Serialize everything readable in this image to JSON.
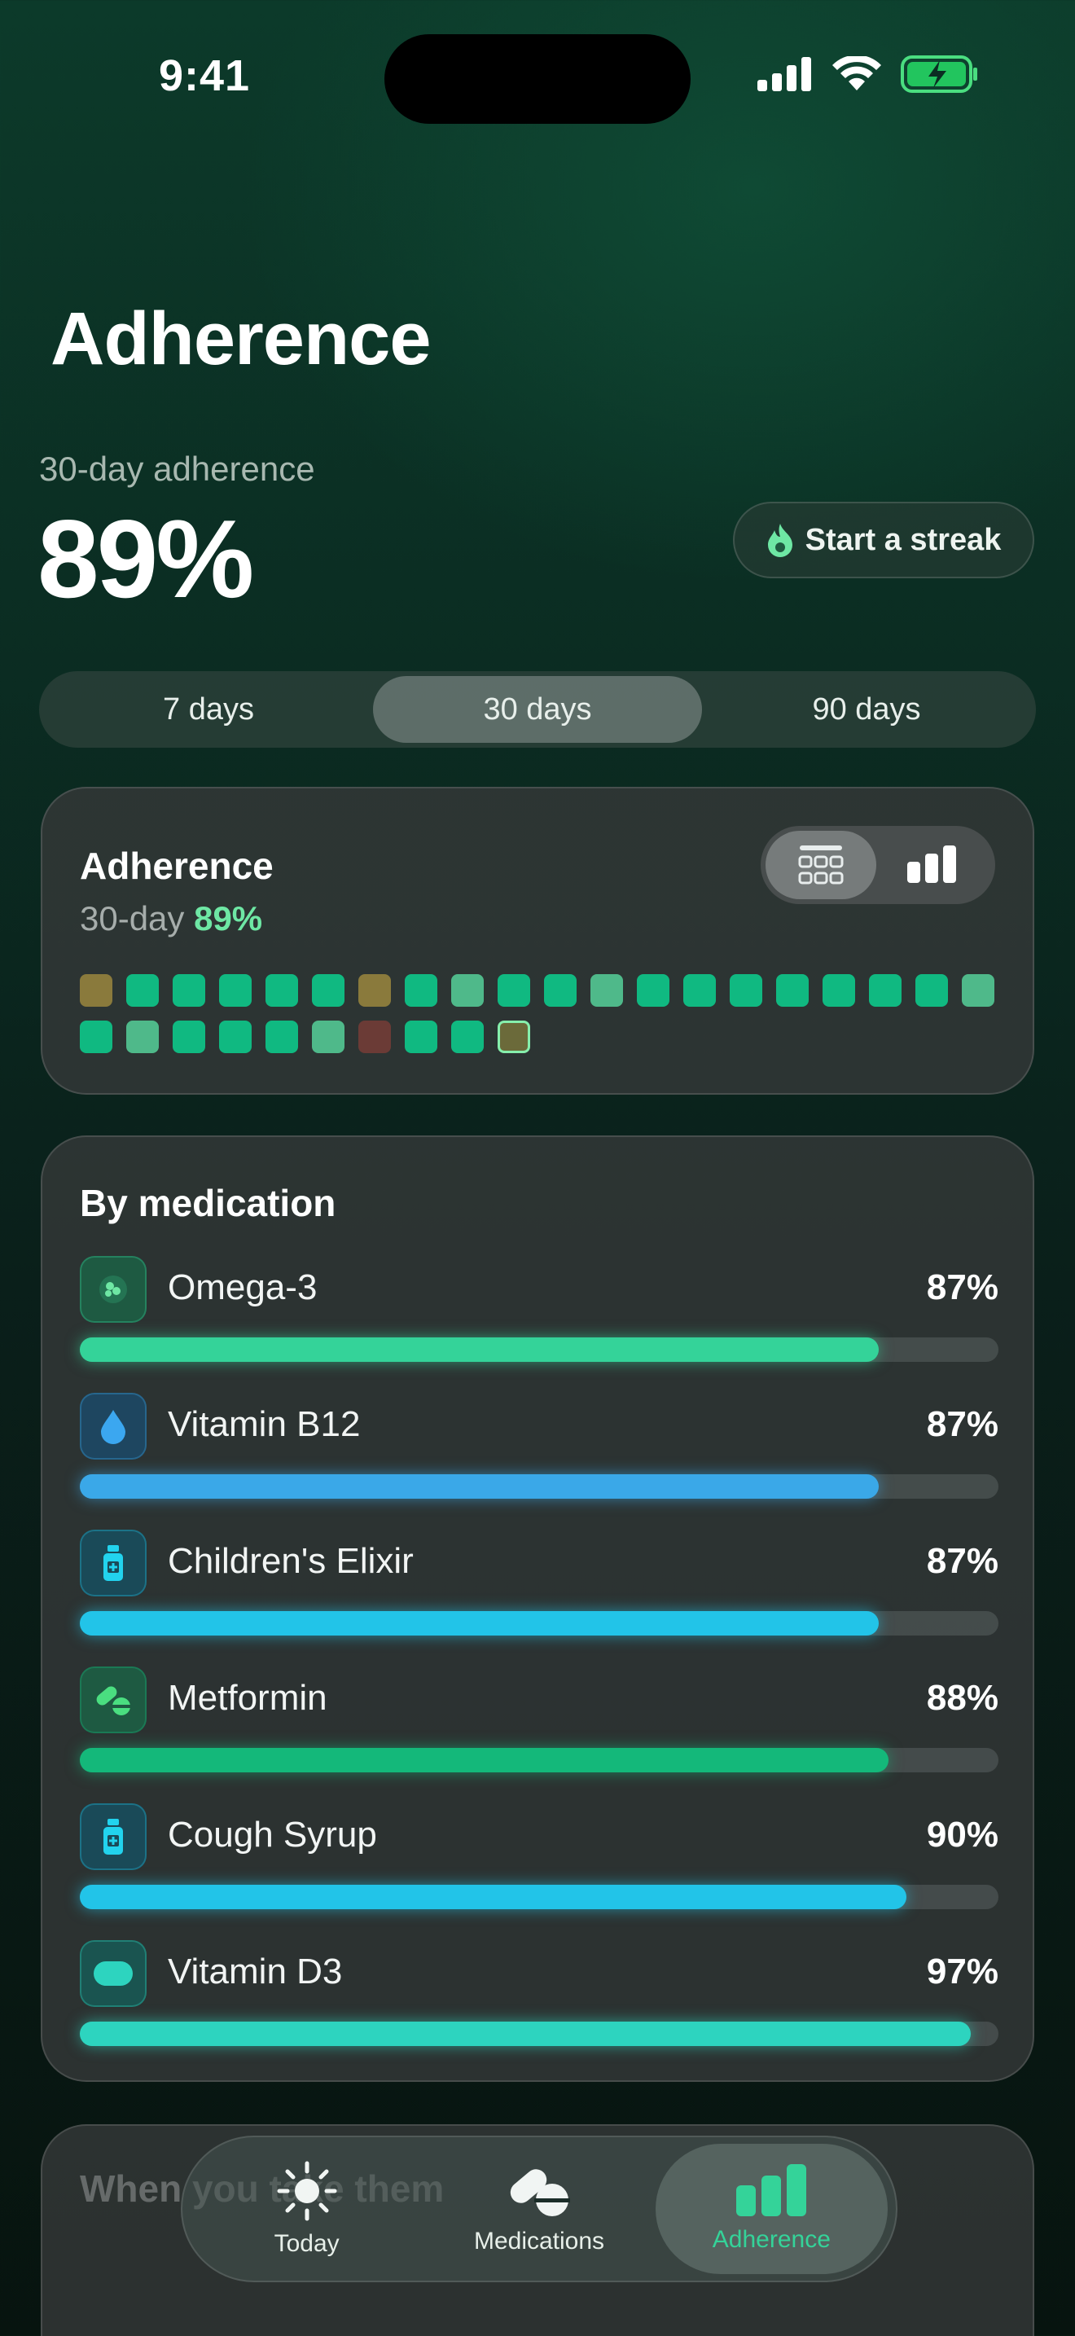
{
  "status_bar": {
    "time": "9:41"
  },
  "header": {
    "title": "Adherence"
  },
  "summary": {
    "label": "30-day adherence",
    "value": "89%",
    "streak_label": "Start a streak"
  },
  "range_tabs": [
    {
      "label": "7 days",
      "active": false
    },
    {
      "label": "30 days",
      "active": true
    },
    {
      "label": "90 days",
      "active": false
    }
  ],
  "adherence_card": {
    "title": "Adherence",
    "sub_prefix": "30-day",
    "sub_value": "89%",
    "days": [
      "partial",
      "taken",
      "taken",
      "taken",
      "taken",
      "taken",
      "partial",
      "taken",
      "mostly",
      "taken",
      "taken",
      "mostly",
      "taken",
      "taken",
      "taken",
      "taken",
      "taken",
      "taken",
      "taken",
      "mostly",
      "taken",
      "mostly",
      "taken",
      "taken",
      "taken",
      "mostly",
      "missed",
      "taken",
      "taken",
      "today"
    ],
    "colors": {
      "taken": "#10b981",
      "mostly": "#4fb98a",
      "partial": "#8a7a3c",
      "missed": "#6b3b36",
      "today": "#6b6a3a"
    }
  },
  "medications_card": {
    "title": "By medication",
    "items": [
      {
        "name": "Omega-3",
        "pct": "87%",
        "value": 0.87,
        "color": "#34d399",
        "icon": "capsule-cluster-icon",
        "tint": "#1e5a42"
      },
      {
        "name": "Vitamin B12",
        "pct": "87%",
        "value": 0.87,
        "color": "#3aa8e8",
        "icon": "droplet-icon",
        "tint": "#1e4660"
      },
      {
        "name": "Children's Elixir",
        "pct": "87%",
        "value": 0.87,
        "color": "#22c4e8",
        "icon": "bottle-icon",
        "tint": "#1a4a58"
      },
      {
        "name": "Metformin",
        "pct": "88%",
        "value": 0.88,
        "color": "#14b87a",
        "icon": "pills-icon",
        "tint": "#1e5a42"
      },
      {
        "name": "Cough Syrup",
        "pct": "90%",
        "value": 0.9,
        "color": "#22c4e8",
        "icon": "bottle-icon",
        "tint": "#1a4a58"
      },
      {
        "name": "Vitamin D3",
        "pct": "97%",
        "value": 0.97,
        "color": "#2dd4bf",
        "icon": "softgel-icon",
        "tint": "#1a5450"
      }
    ]
  },
  "when_card": {
    "title": "When you take them"
  },
  "tab_bar": [
    {
      "label": "Today",
      "icon": "sun-icon",
      "active": false
    },
    {
      "label": "Medications",
      "icon": "pills-icon",
      "active": false
    },
    {
      "label": "Adherence",
      "icon": "bar-chart-icon",
      "active": true
    }
  ]
}
